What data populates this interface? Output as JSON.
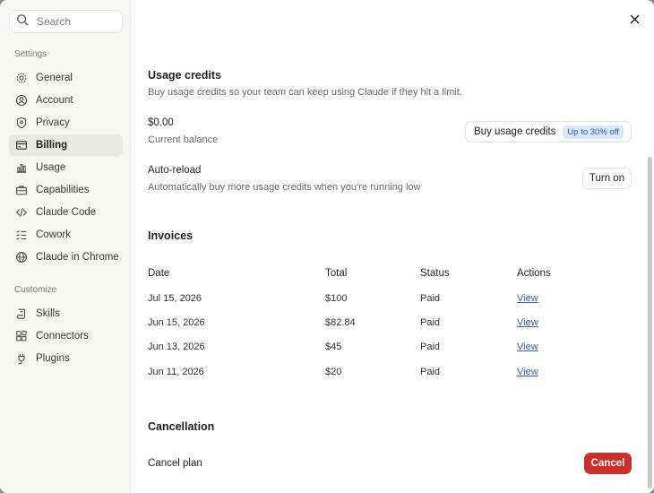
{
  "sidebar": {
    "search_placeholder": "Search",
    "settings_label": "Settings",
    "settings_items": [
      {
        "label": "General",
        "icon": "gear-icon"
      },
      {
        "label": "Account",
        "icon": "user-icon"
      },
      {
        "label": "Privacy",
        "icon": "shield-icon"
      },
      {
        "label": "Billing",
        "icon": "card-icon",
        "active": true
      },
      {
        "label": "Usage",
        "icon": "bar-chart-icon"
      },
      {
        "label": "Capabilities",
        "icon": "toolbox-icon"
      },
      {
        "label": "Claude Code",
        "icon": "code-icon"
      },
      {
        "label": "Cowork",
        "icon": "checklist-icon"
      },
      {
        "label": "Claude in Chrome",
        "icon": "globe-icon"
      }
    ],
    "customize_label": "Customize",
    "customize_items": [
      {
        "label": "Skills",
        "icon": "scroll-icon"
      },
      {
        "label": "Connectors",
        "icon": "blocks-icon"
      },
      {
        "label": "Plugins",
        "icon": "plug-icon"
      }
    ]
  },
  "usage_credits": {
    "title": "Usage credits",
    "description": "Buy usage credits so your team can keep using Claude if they hit a limit.",
    "balance_value": "$0.00",
    "balance_label": "Current balance",
    "buy_button": "Buy usage credits",
    "buy_badge": "Up to 30% off",
    "auto_reload_title": "Auto-reload",
    "auto_reload_desc": "Automatically buy more usage credits when you’re running low",
    "turn_on_button": "Turn on"
  },
  "invoices": {
    "title": "Invoices",
    "headers": [
      "Date",
      "Total",
      "Status",
      "Actions"
    ],
    "rows": [
      {
        "date": "Jul 15, 2026",
        "total": "$100",
        "status": "Paid",
        "action": "View"
      },
      {
        "date": "Jun 15, 2026",
        "total": "$82.84",
        "status": "Paid",
        "action": "View"
      },
      {
        "date": "Jun 13, 2026",
        "total": "$45",
        "status": "Paid",
        "action": "View"
      },
      {
        "date": "Jun 11, 2026",
        "total": "$20",
        "status": "Paid",
        "action": "View"
      }
    ]
  },
  "cancellation": {
    "title": "Cancellation",
    "label": "Cancel plan",
    "button": "Cancel"
  },
  "colors": {
    "accent_link": "#3b5ea0",
    "danger": "#c9302c",
    "badge_bg": "#d9e7fb"
  }
}
